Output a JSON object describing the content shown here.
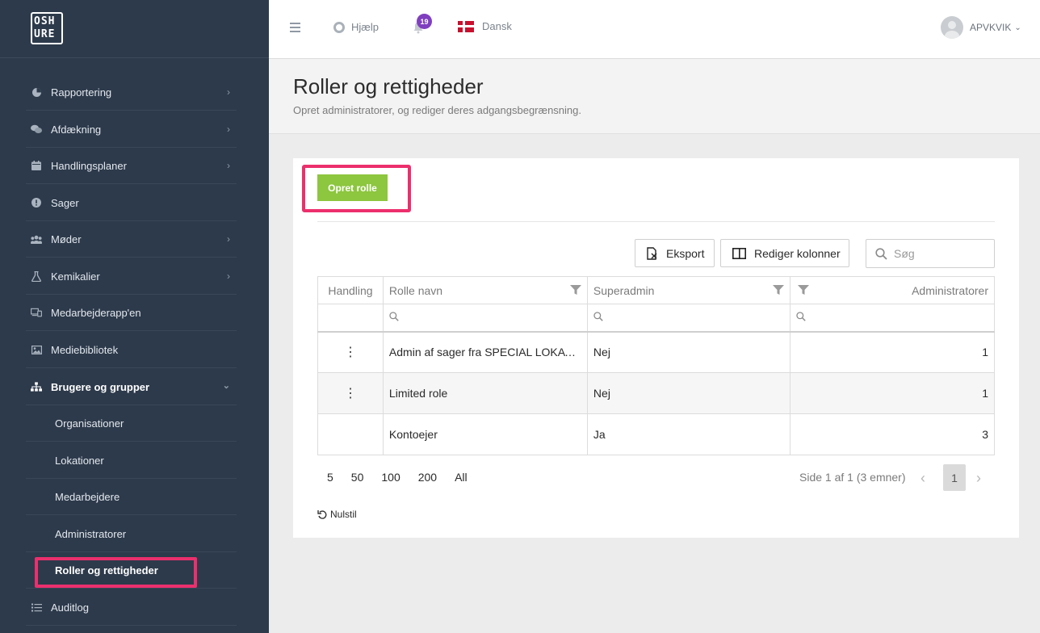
{
  "logo": {
    "line1": "OSH",
    "line2": "URE"
  },
  "sidebar": {
    "items": [
      {
        "label": "Rapportering"
      },
      {
        "label": "Afdækning"
      },
      {
        "label": "Handlingsplaner"
      },
      {
        "label": "Sager"
      },
      {
        "label": "Møder"
      },
      {
        "label": "Kemikalier"
      },
      {
        "label": "Medarbejderapp'en"
      },
      {
        "label": "Mediebibliotek"
      },
      {
        "label": "Brugere og grupper"
      },
      {
        "label": "Auditlog"
      }
    ],
    "subitems": [
      {
        "label": "Organisationer"
      },
      {
        "label": "Lokationer"
      },
      {
        "label": "Medarbejdere"
      },
      {
        "label": "Administratorer"
      },
      {
        "label": "Roller og rettigheder"
      }
    ]
  },
  "topbar": {
    "help_label": "Hjælp",
    "notification_count": "19",
    "language_label": "Dansk",
    "username": "APVKVIK"
  },
  "page": {
    "title": "Roller og rettigheder",
    "subtitle": "Opret administratorer, og rediger deres adgangsbegrænsning."
  },
  "toolbar": {
    "create_label": "Opret rolle",
    "export_label": "Eksport",
    "edit_columns_label": "Rediger kolonner",
    "search_placeholder": "Søg"
  },
  "table": {
    "columns": [
      "Handling",
      "Rolle navn",
      "Superadmin",
      "Administratorer"
    ],
    "rows": [
      {
        "action": "⋮",
        "name": "Admin af sager fra SPECIAL LOKATION",
        "superadmin": "Nej",
        "admins": "1"
      },
      {
        "action": "⋮",
        "name": "Limited role",
        "superadmin": "Nej",
        "admins": "1"
      },
      {
        "action": "",
        "name": "Kontoejer",
        "superadmin": "Ja",
        "admins": "3"
      }
    ]
  },
  "pager": {
    "sizes": [
      "5",
      "50",
      "100",
      "200",
      "All"
    ],
    "info": "Side 1 af 1 (3 emner)",
    "current_page": "1",
    "reset_label": "Nulstil"
  },
  "colors": {
    "sidebar_bg": "#2d3a4b",
    "accent_green": "#8dc63f",
    "highlight": "#ec2f6d",
    "badge": "#7f3fbf"
  }
}
